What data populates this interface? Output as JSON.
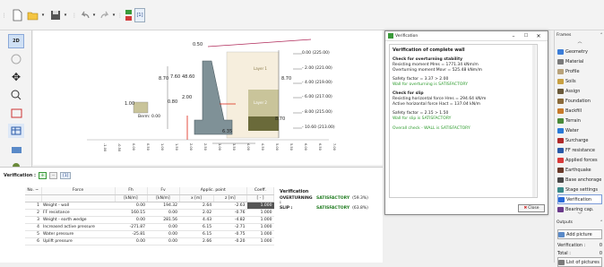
{
  "toolbar": {
    "fix_label": "[1]"
  },
  "drawing": {
    "dims": [
      "8.70",
      "7.60",
      "48.60",
      "8.70",
      "8.70",
      "0.80",
      "2.00",
      "6.35",
      "0.50",
      "0.50",
      "1.00",
      "0.60",
      "4.50",
      "1.50"
    ],
    "berm_label": "Berm: 0.00",
    "layer_labels": [
      "Layer 1",
      "Layer 2"
    ],
    "right_elev": [
      "0.00 (225.00)",
      "- 2.00 (221.00)",
      "- 4.00 (219.00)",
      "- 6.00 (217.00)",
      "- 8.00 (215.00)",
      "- 10.60 (213.00)"
    ],
    "axis_ticks": [
      "-1.00",
      "-0.50",
      "0.00",
      "0.50",
      "1.00",
      "1.50",
      "2.00",
      "2.50",
      "3.00",
      "3.50",
      "4.00",
      "4.50",
      "5.00",
      "5.50",
      "6.00",
      "6.50",
      "7.00"
    ]
  },
  "verification_bar": {
    "label": "Verification :",
    "tag": "[1]"
  },
  "table": {
    "headers": [
      "No. ~",
      "Force",
      "Fh",
      "Fv",
      "Applic. point",
      "",
      "Coeff."
    ],
    "units": [
      "",
      "",
      "[kN/m]",
      "[kN/m]",
      "x [m]",
      "z [m]",
      "[ - ]"
    ],
    "rows": [
      {
        "no": "1",
        "force": "Weight - wall",
        "fh": "0.00",
        "fv": "194.32",
        "x": "2.64",
        "z": "-2.63",
        "c": "1.000"
      },
      {
        "no": "2",
        "force": "FF resistance",
        "fh": "160.15",
        "fv": "0.00",
        "x": "2.02",
        "z": "-0.76",
        "c": "1.000"
      },
      {
        "no": "3",
        "force": "Weight - earth wedge",
        "fh": "0.00",
        "fv": "281.56",
        "x": "4.43",
        "z": "-4.82",
        "c": "1.000"
      },
      {
        "no": "4",
        "force": "Increased active pressure",
        "fh": "-271.87",
        "fv": "0.00",
        "x": "6.15",
        "z": "-2.71",
        "c": "1.000"
      },
      {
        "no": "5",
        "force": "Water pressure",
        "fh": "-25.81",
        "fv": "0.00",
        "x": "6.15",
        "z": "-0.75",
        "c": "1.000"
      },
      {
        "no": "6",
        "force": "Uplift pressure",
        "fh": "0.00",
        "fv": "0.00",
        "x": "2.66",
        "z": "-0.20",
        "c": "1.000"
      }
    ]
  },
  "verif_summary": {
    "title": "Verification",
    "rows": [
      {
        "label": "OVERTURNING :",
        "status": "SATISFACTORY",
        "pct": "(59.3%)"
      },
      {
        "label": "SLIP :",
        "status": "SATISFACTORY",
        "pct": "(63.8%)"
      }
    ]
  },
  "dialog": {
    "title": "Verification",
    "heading": "Verification of complete wall",
    "ov_head": "Check for overturning stability",
    "ov_lines": [
      "Resisting moment     Mres =  1771.34  kNm/m",
      "Overturning moment  Movr =   525.48  kNm/m"
    ],
    "ov_sf": "Safety factor = 3.37 > 2.00",
    "ov_ok": "Wall for overturning is SATISFACTORY",
    "sl_head": "Check for slip",
    "sl_lines": [
      "Resisting horizontal force  Hres =  294.64  kN/m",
      "Active horizontal force       Hact =  137.04  kN/m"
    ],
    "sl_sf": "Safety factor = 2.15 > 1.50",
    "sl_ok": "Wall for slip is SATISFACTORY",
    "overall": "Overall check - WALL is SATISFACTORY",
    "close": "Close"
  },
  "frames": {
    "title": "Frames",
    "items": [
      {
        "label": "Geometry",
        "color": "#3b7dd8"
      },
      {
        "label": "Material",
        "color": "#7a7a7a"
      },
      {
        "label": "Profile",
        "color": "#b8a27a"
      },
      {
        "label": "Soils",
        "color": "#c8a040"
      },
      {
        "label": "Assign",
        "color": "#6a5a3a"
      },
      {
        "label": "Foundation",
        "color": "#8a6a3a"
      },
      {
        "label": "Backfill",
        "color": "#c87a2a"
      },
      {
        "label": "Terrain",
        "color": "#4a8a3a"
      },
      {
        "label": "Water",
        "color": "#2a7ad8"
      },
      {
        "label": "Surcharge",
        "color": "#b02a2a"
      },
      {
        "label": "FF resistance",
        "color": "#2a5aa8"
      },
      {
        "label": "Applied forces",
        "color": "#d83a3a"
      },
      {
        "label": "Earthquake",
        "color": "#6a3a2a"
      },
      {
        "label": "Base anchorage",
        "color": "#4a4a4a"
      },
      {
        "label": "Stage settings",
        "color": "#3a8a8a"
      },
      {
        "label": "Verification",
        "color": "#2a6ad8"
      },
      {
        "label": "Bearing cap.",
        "color": "#6a3a8a"
      }
    ],
    "active": "Verification"
  },
  "outputs": {
    "title": "Outputs",
    "add": "Add picture",
    "verif": "Verification :",
    "verif_val": "0",
    "total": "Total :",
    "total_val": "0",
    "list": "List of pictures"
  }
}
